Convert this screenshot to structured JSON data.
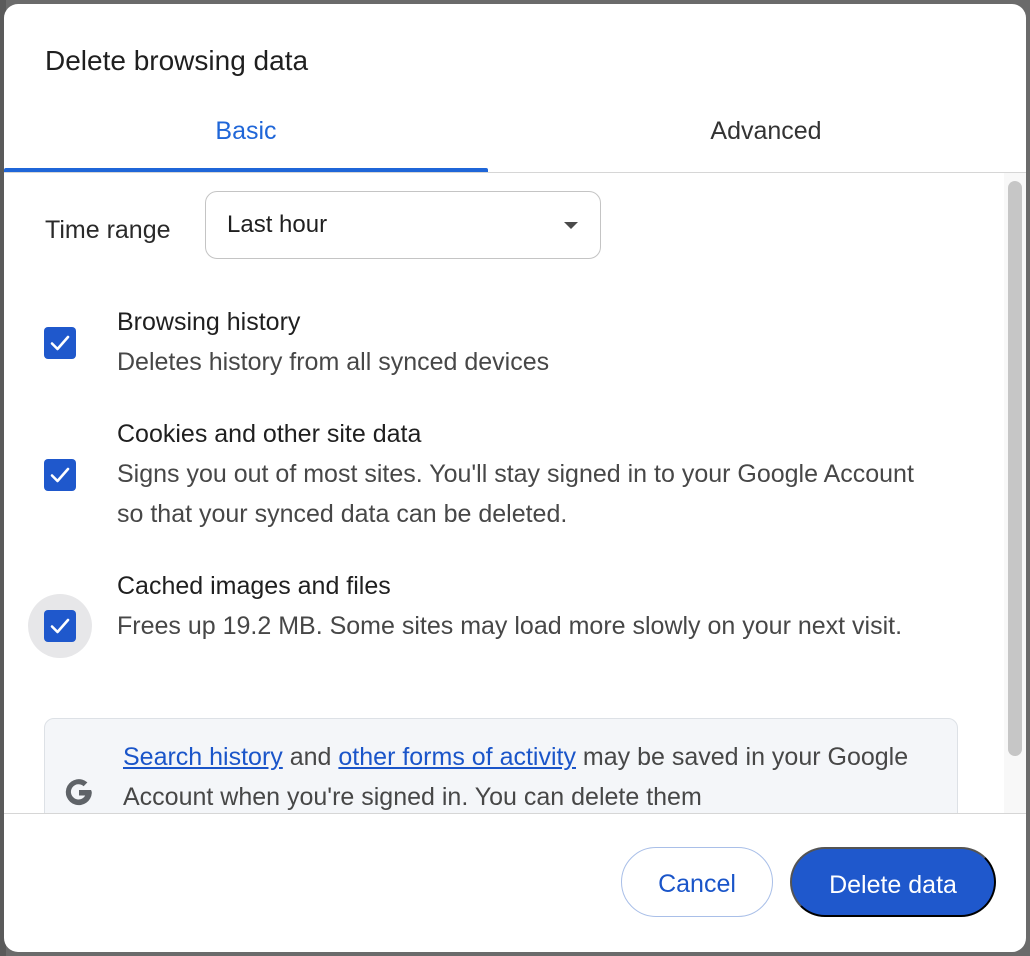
{
  "dialog": {
    "title": "Delete browsing data"
  },
  "tabs": [
    {
      "label": "Basic",
      "selected": true
    },
    {
      "label": "Advanced",
      "selected": false
    }
  ],
  "time_range": {
    "label": "Time range",
    "value": "Last hour"
  },
  "options": [
    {
      "title": "Browsing history",
      "description": "Deletes history from all synced devices",
      "checked": true
    },
    {
      "title": "Cookies and other site data",
      "description": "Signs you out of most sites. You'll stay signed in to your Google Account so that your synced data can be deleted.",
      "checked": true
    },
    {
      "title": "Cached images and files",
      "description": "Frees up 19.2 MB. Some sites may load more slowly on your next visit.",
      "checked": true,
      "focused": true
    }
  ],
  "notice": {
    "link1": "Search history",
    "text1": " and ",
    "link2": "other forms of activity",
    "text2": " may be saved in your Google Account when you're signed in. You can delete them"
  },
  "buttons": {
    "cancel": "Cancel",
    "delete": "Delete data"
  },
  "colors": {
    "accent": "#1f58cc",
    "tab_selected": "#1f66d8",
    "link": "#1a55c9"
  },
  "icons": {
    "checkbox": "checkmark-icon",
    "select": "caret-down-icon",
    "notice": "google-g-icon"
  }
}
